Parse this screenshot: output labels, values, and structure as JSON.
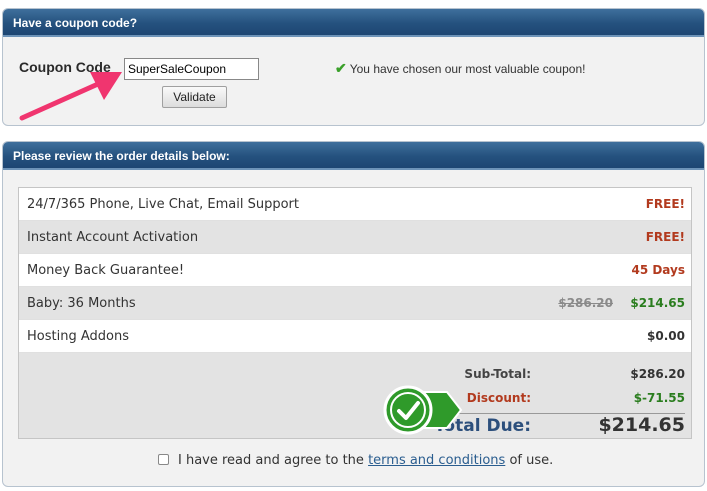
{
  "coupon": {
    "header": "Have a coupon code?",
    "label": "Coupon Code",
    "value": "SuperSaleCoupon",
    "validate_label": "Validate",
    "message": "You have chosen our most valuable coupon!"
  },
  "order": {
    "header": "Please review the order details below:",
    "items": [
      {
        "label": "24/7/365 Phone, Live Chat, Email Support",
        "value": "FREE!"
      },
      {
        "label": "Instant Account Activation",
        "value": "FREE!"
      },
      {
        "label": "Money Back Guarantee!",
        "value": "45 Days"
      },
      {
        "label": "Baby: 36 Months",
        "old_price": "$286.20",
        "value": "$214.65"
      },
      {
        "label": "Hosting Addons",
        "value": "$0.00"
      }
    ],
    "subtotal_label": "Sub-Total:",
    "subtotal_value": "$286.20",
    "discount_label": "Discount:",
    "discount_value": "$-71.55",
    "total_label": "Total Due:",
    "total_value": "$214.65"
  },
  "agreement": {
    "prefix": "I have read and agree to the",
    "link": "terms and conditions",
    "suffix": "of use."
  },
  "icons": [
    "check-icon",
    "arrow-icon",
    "check-badge-icon",
    "checkbox"
  ],
  "colors": {
    "header_blue": "#25527f",
    "free_red": "#b23a1e",
    "price_green": "#2a7d1e",
    "total_blue": "#2c4f7c",
    "arrow_pink": "#f0356f"
  }
}
